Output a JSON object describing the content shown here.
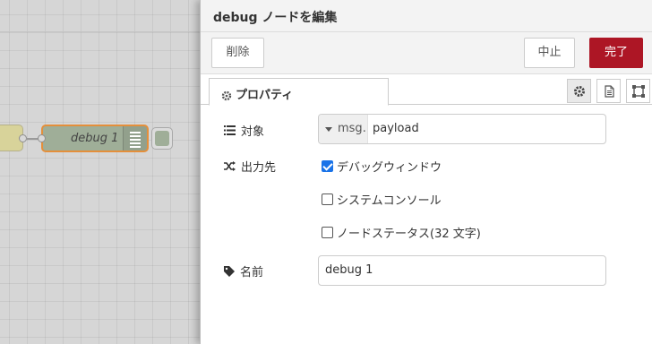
{
  "tray": {
    "title": "debug ノードを編集",
    "delete_label": "削除",
    "cancel_label": "中止",
    "done_label": "完了"
  },
  "tabs": {
    "properties_label": "プロパティ",
    "icons": [
      "gear-icon",
      "description-icon",
      "appearance-icon"
    ]
  },
  "form": {
    "target": {
      "label": "対象",
      "type_label": "msg.",
      "value": "payload"
    },
    "output": {
      "label": "出力先",
      "options": [
        {
          "label": "デバッグウィンドウ",
          "checked": true
        },
        {
          "label": "システムコンソール",
          "checked": false
        },
        {
          "label": "ノードステータス(32 文字)",
          "checked": false
        }
      ]
    },
    "name": {
      "label": "名前",
      "value": "debug 1"
    }
  },
  "workspace": {
    "node_label": "debug 1",
    "node_color": "#9fae98",
    "selected_border_color": "#e48f3b"
  },
  "colors": {
    "primary_button": "#ad1625",
    "checkbox_checked": "#1a73e8"
  }
}
